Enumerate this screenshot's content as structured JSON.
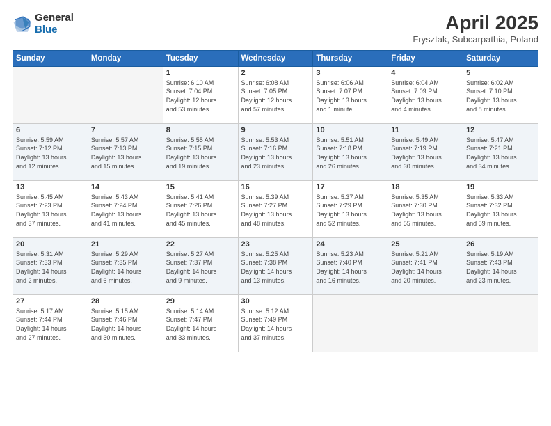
{
  "header": {
    "logo_general": "General",
    "logo_blue": "Blue",
    "title": "April 2025",
    "subtitle": "Frysztak, Subcarpathia, Poland"
  },
  "weekdays": [
    "Sunday",
    "Monday",
    "Tuesday",
    "Wednesday",
    "Thursday",
    "Friday",
    "Saturday"
  ],
  "weeks": [
    [
      {
        "day": "",
        "empty": true
      },
      {
        "day": "",
        "empty": true
      },
      {
        "day": "1",
        "line1": "Sunrise: 6:10 AM",
        "line2": "Sunset: 7:04 PM",
        "line3": "Daylight: 12 hours",
        "line4": "and 53 minutes."
      },
      {
        "day": "2",
        "line1": "Sunrise: 6:08 AM",
        "line2": "Sunset: 7:05 PM",
        "line3": "Daylight: 12 hours",
        "line4": "and 57 minutes."
      },
      {
        "day": "3",
        "line1": "Sunrise: 6:06 AM",
        "line2": "Sunset: 7:07 PM",
        "line3": "Daylight: 13 hours",
        "line4": "and 1 minute."
      },
      {
        "day": "4",
        "line1": "Sunrise: 6:04 AM",
        "line2": "Sunset: 7:09 PM",
        "line3": "Daylight: 13 hours",
        "line4": "and 4 minutes."
      },
      {
        "day": "5",
        "line1": "Sunrise: 6:02 AM",
        "line2": "Sunset: 7:10 PM",
        "line3": "Daylight: 13 hours",
        "line4": "and 8 minutes."
      }
    ],
    [
      {
        "day": "6",
        "line1": "Sunrise: 5:59 AM",
        "line2": "Sunset: 7:12 PM",
        "line3": "Daylight: 13 hours",
        "line4": "and 12 minutes."
      },
      {
        "day": "7",
        "line1": "Sunrise: 5:57 AM",
        "line2": "Sunset: 7:13 PM",
        "line3": "Daylight: 13 hours",
        "line4": "and 15 minutes."
      },
      {
        "day": "8",
        "line1": "Sunrise: 5:55 AM",
        "line2": "Sunset: 7:15 PM",
        "line3": "Daylight: 13 hours",
        "line4": "and 19 minutes."
      },
      {
        "day": "9",
        "line1": "Sunrise: 5:53 AM",
        "line2": "Sunset: 7:16 PM",
        "line3": "Daylight: 13 hours",
        "line4": "and 23 minutes."
      },
      {
        "day": "10",
        "line1": "Sunrise: 5:51 AM",
        "line2": "Sunset: 7:18 PM",
        "line3": "Daylight: 13 hours",
        "line4": "and 26 minutes."
      },
      {
        "day": "11",
        "line1": "Sunrise: 5:49 AM",
        "line2": "Sunset: 7:19 PM",
        "line3": "Daylight: 13 hours",
        "line4": "and 30 minutes."
      },
      {
        "day": "12",
        "line1": "Sunrise: 5:47 AM",
        "line2": "Sunset: 7:21 PM",
        "line3": "Daylight: 13 hours",
        "line4": "and 34 minutes."
      }
    ],
    [
      {
        "day": "13",
        "line1": "Sunrise: 5:45 AM",
        "line2": "Sunset: 7:23 PM",
        "line3": "Daylight: 13 hours",
        "line4": "and 37 minutes."
      },
      {
        "day": "14",
        "line1": "Sunrise: 5:43 AM",
        "line2": "Sunset: 7:24 PM",
        "line3": "Daylight: 13 hours",
        "line4": "and 41 minutes."
      },
      {
        "day": "15",
        "line1": "Sunrise: 5:41 AM",
        "line2": "Sunset: 7:26 PM",
        "line3": "Daylight: 13 hours",
        "line4": "and 45 minutes."
      },
      {
        "day": "16",
        "line1": "Sunrise: 5:39 AM",
        "line2": "Sunset: 7:27 PM",
        "line3": "Daylight: 13 hours",
        "line4": "and 48 minutes."
      },
      {
        "day": "17",
        "line1": "Sunrise: 5:37 AM",
        "line2": "Sunset: 7:29 PM",
        "line3": "Daylight: 13 hours",
        "line4": "and 52 minutes."
      },
      {
        "day": "18",
        "line1": "Sunrise: 5:35 AM",
        "line2": "Sunset: 7:30 PM",
        "line3": "Daylight: 13 hours",
        "line4": "and 55 minutes."
      },
      {
        "day": "19",
        "line1": "Sunrise: 5:33 AM",
        "line2": "Sunset: 7:32 PM",
        "line3": "Daylight: 13 hours",
        "line4": "and 59 minutes."
      }
    ],
    [
      {
        "day": "20",
        "line1": "Sunrise: 5:31 AM",
        "line2": "Sunset: 7:33 PM",
        "line3": "Daylight: 14 hours",
        "line4": "and 2 minutes."
      },
      {
        "day": "21",
        "line1": "Sunrise: 5:29 AM",
        "line2": "Sunset: 7:35 PM",
        "line3": "Daylight: 14 hours",
        "line4": "and 6 minutes."
      },
      {
        "day": "22",
        "line1": "Sunrise: 5:27 AM",
        "line2": "Sunset: 7:37 PM",
        "line3": "Daylight: 14 hours",
        "line4": "and 9 minutes."
      },
      {
        "day": "23",
        "line1": "Sunrise: 5:25 AM",
        "line2": "Sunset: 7:38 PM",
        "line3": "Daylight: 14 hours",
        "line4": "and 13 minutes."
      },
      {
        "day": "24",
        "line1": "Sunrise: 5:23 AM",
        "line2": "Sunset: 7:40 PM",
        "line3": "Daylight: 14 hours",
        "line4": "and 16 minutes."
      },
      {
        "day": "25",
        "line1": "Sunrise: 5:21 AM",
        "line2": "Sunset: 7:41 PM",
        "line3": "Daylight: 14 hours",
        "line4": "and 20 minutes."
      },
      {
        "day": "26",
        "line1": "Sunrise: 5:19 AM",
        "line2": "Sunset: 7:43 PM",
        "line3": "Daylight: 14 hours",
        "line4": "and 23 minutes."
      }
    ],
    [
      {
        "day": "27",
        "line1": "Sunrise: 5:17 AM",
        "line2": "Sunset: 7:44 PM",
        "line3": "Daylight: 14 hours",
        "line4": "and 27 minutes."
      },
      {
        "day": "28",
        "line1": "Sunrise: 5:15 AM",
        "line2": "Sunset: 7:46 PM",
        "line3": "Daylight: 14 hours",
        "line4": "and 30 minutes."
      },
      {
        "day": "29",
        "line1": "Sunrise: 5:14 AM",
        "line2": "Sunset: 7:47 PM",
        "line3": "Daylight: 14 hours",
        "line4": "and 33 minutes."
      },
      {
        "day": "30",
        "line1": "Sunrise: 5:12 AM",
        "line2": "Sunset: 7:49 PM",
        "line3": "Daylight: 14 hours",
        "line4": "and 37 minutes."
      },
      {
        "day": "",
        "empty": true
      },
      {
        "day": "",
        "empty": true
      },
      {
        "day": "",
        "empty": true
      }
    ]
  ]
}
